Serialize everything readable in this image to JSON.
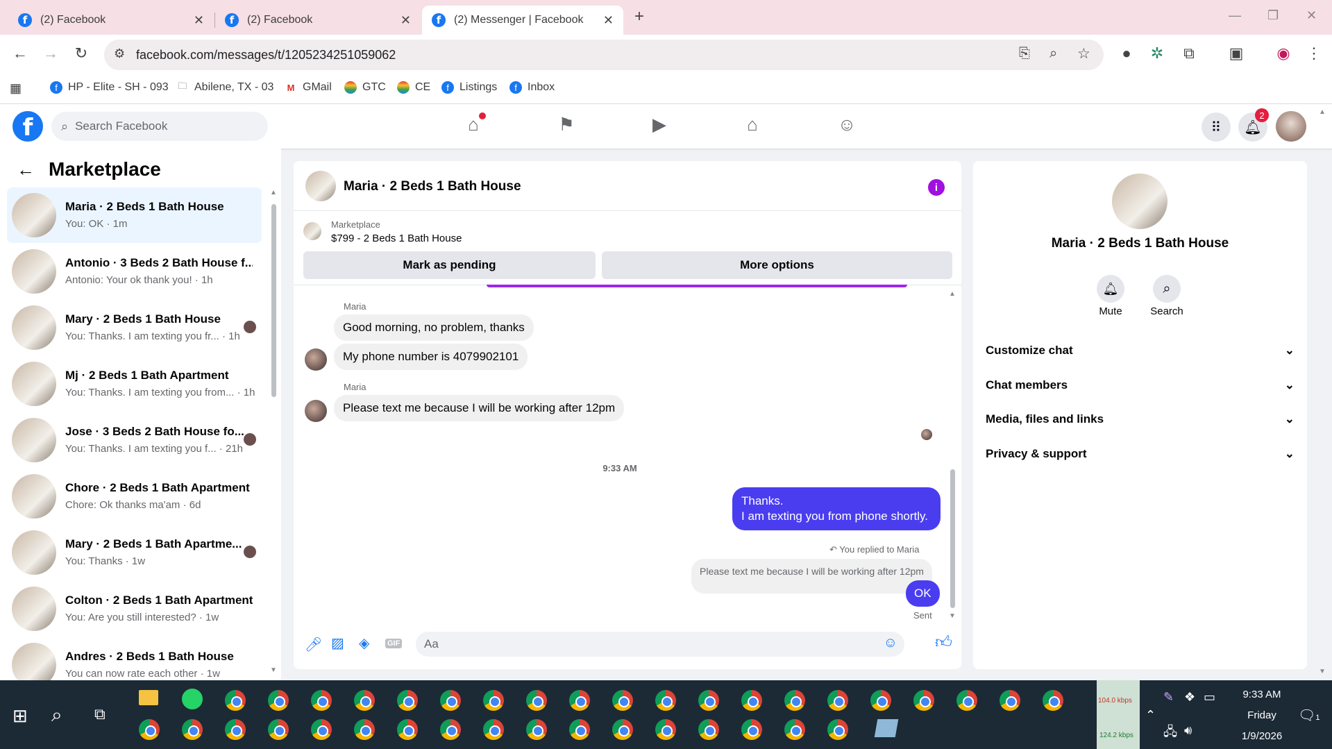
{
  "browser": {
    "tabs": [
      {
        "title": "(2) Facebook",
        "active": false
      },
      {
        "title": "(2) Facebook",
        "active": false
      },
      {
        "title": "(2) Messenger | Facebook",
        "active": true
      }
    ],
    "url": "facebook.com/messages/t/1205234251059062",
    "bookmarks": [
      {
        "label": "HP - Elite - SH - 093",
        "icon": "facebook-icon"
      },
      {
        "label": "Abilene, TX - 03",
        "icon": "folder-icon"
      },
      {
        "label": "GMail",
        "icon": "gmail-icon"
      },
      {
        "label": "GTC",
        "icon": "rainbow-icon"
      },
      {
        "label": "CE",
        "icon": "rainbow-icon"
      },
      {
        "label": "Listings",
        "icon": "facebook-icon"
      },
      {
        "label": "Inbox",
        "icon": "facebook-icon"
      }
    ]
  },
  "fb": {
    "search_placeholder": "Search Facebook",
    "notifications_count": "2"
  },
  "sidebar": {
    "title": "Marketplace",
    "conversations": [
      {
        "title": "Maria · 2 Beds 1 Bath House",
        "sub": "You: OK · 1m",
        "selected": true
      },
      {
        "title": "Antonio · 3 Beds 2 Bath House f...",
        "sub": "Antonio: Your ok thank you! · 1h"
      },
      {
        "title": "Mary · 2 Beds 1 Bath House",
        "sub": "You: Thanks. I am texting you fr... · 1h"
      },
      {
        "title": "Mj · 2 Beds 1 Bath Apartment",
        "sub": "You: Thanks. I am texting you from... · 1h"
      },
      {
        "title": "Jose · 3 Beds 2 Bath House fo...",
        "sub": "You: Thanks. I am texting you f... · 21h"
      },
      {
        "title": "Chore · 2 Beds 1 Bath Apartment",
        "sub": "Chore: Ok thanks ma'am · 6d"
      },
      {
        "title": "Mary · 2 Beds 1 Bath Apartme...",
        "sub": "You: Thanks · 1w"
      },
      {
        "title": "Colton · 2 Beds 1 Bath Apartment",
        "sub": "You: Are you still interested? · 1w"
      },
      {
        "title": "Andres · 2 Beds 1 Bath House",
        "sub": "You can now rate each other · 1w"
      }
    ]
  },
  "chat": {
    "title": "Maria · 2 Beds 1 Bath House",
    "marketplace_label": "Marketplace",
    "listing": "$799 - 2 Beds 1 Bath House",
    "mark_pending": "Mark as pending",
    "more_options": "More options",
    "sender_name": "Maria",
    "msg1": "Good morning, no problem, thanks",
    "msg2": "My phone number is 4079902101",
    "msg3": "Please text me because I will be working after 12pm",
    "timestamp": "9:33 AM",
    "my_msg": "Thanks.\nI am texting you from phone shortly.",
    "replied_label": "You replied to Maria",
    "quoted": "Please text me because I will be working after 12pm",
    "ok": "OK",
    "sent": "Sent",
    "composer_placeholder": "Aa"
  },
  "details": {
    "name": "Maria · 2 Beds 1 Bath House",
    "mute": "Mute",
    "search": "Search",
    "sections": [
      "Customize chat",
      "Chat members",
      "Media, files and links",
      "Privacy & support"
    ]
  },
  "taskbar": {
    "net_up": "104.0 kbps",
    "net_down": "124.2 kbps",
    "time": "9:33 AM",
    "day": "Friday",
    "date": "1/9/2026",
    "notif_count": "1"
  }
}
